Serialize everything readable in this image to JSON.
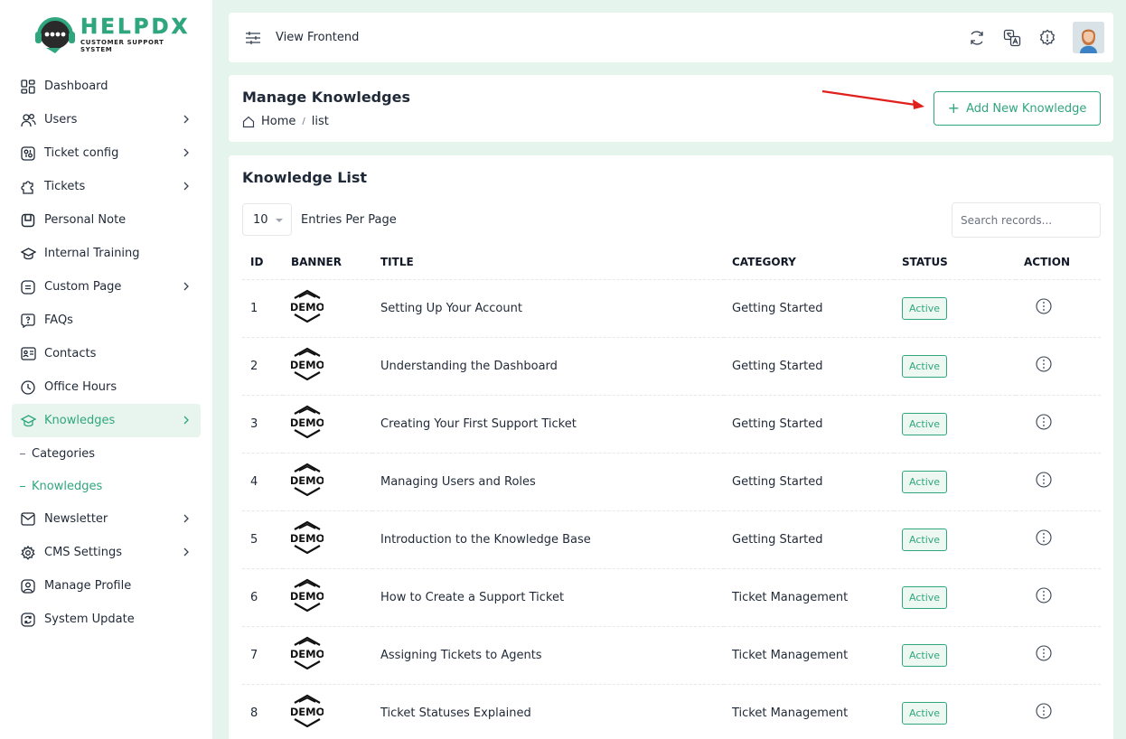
{
  "brand": {
    "title": "HELPDX",
    "subtitle": "CUSTOMER SUPPORT SYSTEM",
    "accent": "#2fa67e"
  },
  "sidebar": {
    "items": [
      {
        "label": "Dashboard",
        "icon": "dashboard-icon",
        "chevron": false
      },
      {
        "label": "Users",
        "icon": "users-icon",
        "chevron": true
      },
      {
        "label": "Ticket config",
        "icon": "ticket-config-icon",
        "chevron": true
      },
      {
        "label": "Tickets",
        "icon": "tickets-icon",
        "chevron": true
      },
      {
        "label": "Personal Note",
        "icon": "note-icon",
        "chevron": false
      },
      {
        "label": "Internal Training",
        "icon": "training-icon",
        "chevron": false
      },
      {
        "label": "Custom Page",
        "icon": "page-icon",
        "chevron": true
      },
      {
        "label": "FAQs",
        "icon": "faq-icon",
        "chevron": false
      },
      {
        "label": "Contacts",
        "icon": "contacts-icon",
        "chevron": false
      },
      {
        "label": "Office Hours",
        "icon": "clock-icon",
        "chevron": false
      },
      {
        "label": "Knowledges",
        "icon": "knowledge-icon",
        "chevron": true,
        "active": true
      },
      {
        "label": "Newsletter",
        "icon": "newsletter-icon",
        "chevron": true
      },
      {
        "label": "CMS Settings",
        "icon": "settings-icon",
        "chevron": true
      },
      {
        "label": "Manage Profile",
        "icon": "profile-icon",
        "chevron": false
      },
      {
        "label": "System Update",
        "icon": "update-icon",
        "chevron": false
      }
    ],
    "subitems": [
      {
        "label": "Categories"
      },
      {
        "label": "Knowledges",
        "active": true
      }
    ]
  },
  "topbar": {
    "view_frontend": "View Frontend",
    "icons": [
      "refresh-icon",
      "translate-icon",
      "alert-icon"
    ]
  },
  "header": {
    "title": "Manage Knowledges",
    "breadcrumb": {
      "home": "Home",
      "current": "list"
    },
    "add_button": "Add New Knowledge"
  },
  "list": {
    "title": "Knowledge List",
    "per_page_value": "10",
    "per_page_label": "Entries Per Page",
    "search_placeholder": "Search records...",
    "columns": [
      "ID",
      "BANNER",
      "TITLE",
      "CATEGORY",
      "STATUS",
      "ACTION"
    ],
    "rows": [
      {
        "id": "1",
        "banner": "DEMO",
        "title": "Setting Up Your Account",
        "category": "Getting Started",
        "status": "Active"
      },
      {
        "id": "2",
        "banner": "DEMO",
        "title": "Understanding the Dashboard",
        "category": "Getting Started",
        "status": "Active"
      },
      {
        "id": "3",
        "banner": "DEMO",
        "title": "Creating Your First Support Ticket",
        "category": "Getting Started",
        "status": "Active"
      },
      {
        "id": "4",
        "banner": "DEMO",
        "title": "Managing Users and Roles",
        "category": "Getting Started",
        "status": "Active"
      },
      {
        "id": "5",
        "banner": "DEMO",
        "title": "Introduction to the Knowledge Base",
        "category": "Getting Started",
        "status": "Active"
      },
      {
        "id": "6",
        "banner": "DEMO",
        "title": "How to Create a Support Ticket",
        "category": "Ticket Management",
        "status": "Active"
      },
      {
        "id": "7",
        "banner": "DEMO",
        "title": "Assigning Tickets to Agents",
        "category": "Ticket Management",
        "status": "Active"
      },
      {
        "id": "8",
        "banner": "DEMO",
        "title": "Ticket Statuses Explained",
        "category": "Ticket Management",
        "status": "Active"
      }
    ]
  }
}
